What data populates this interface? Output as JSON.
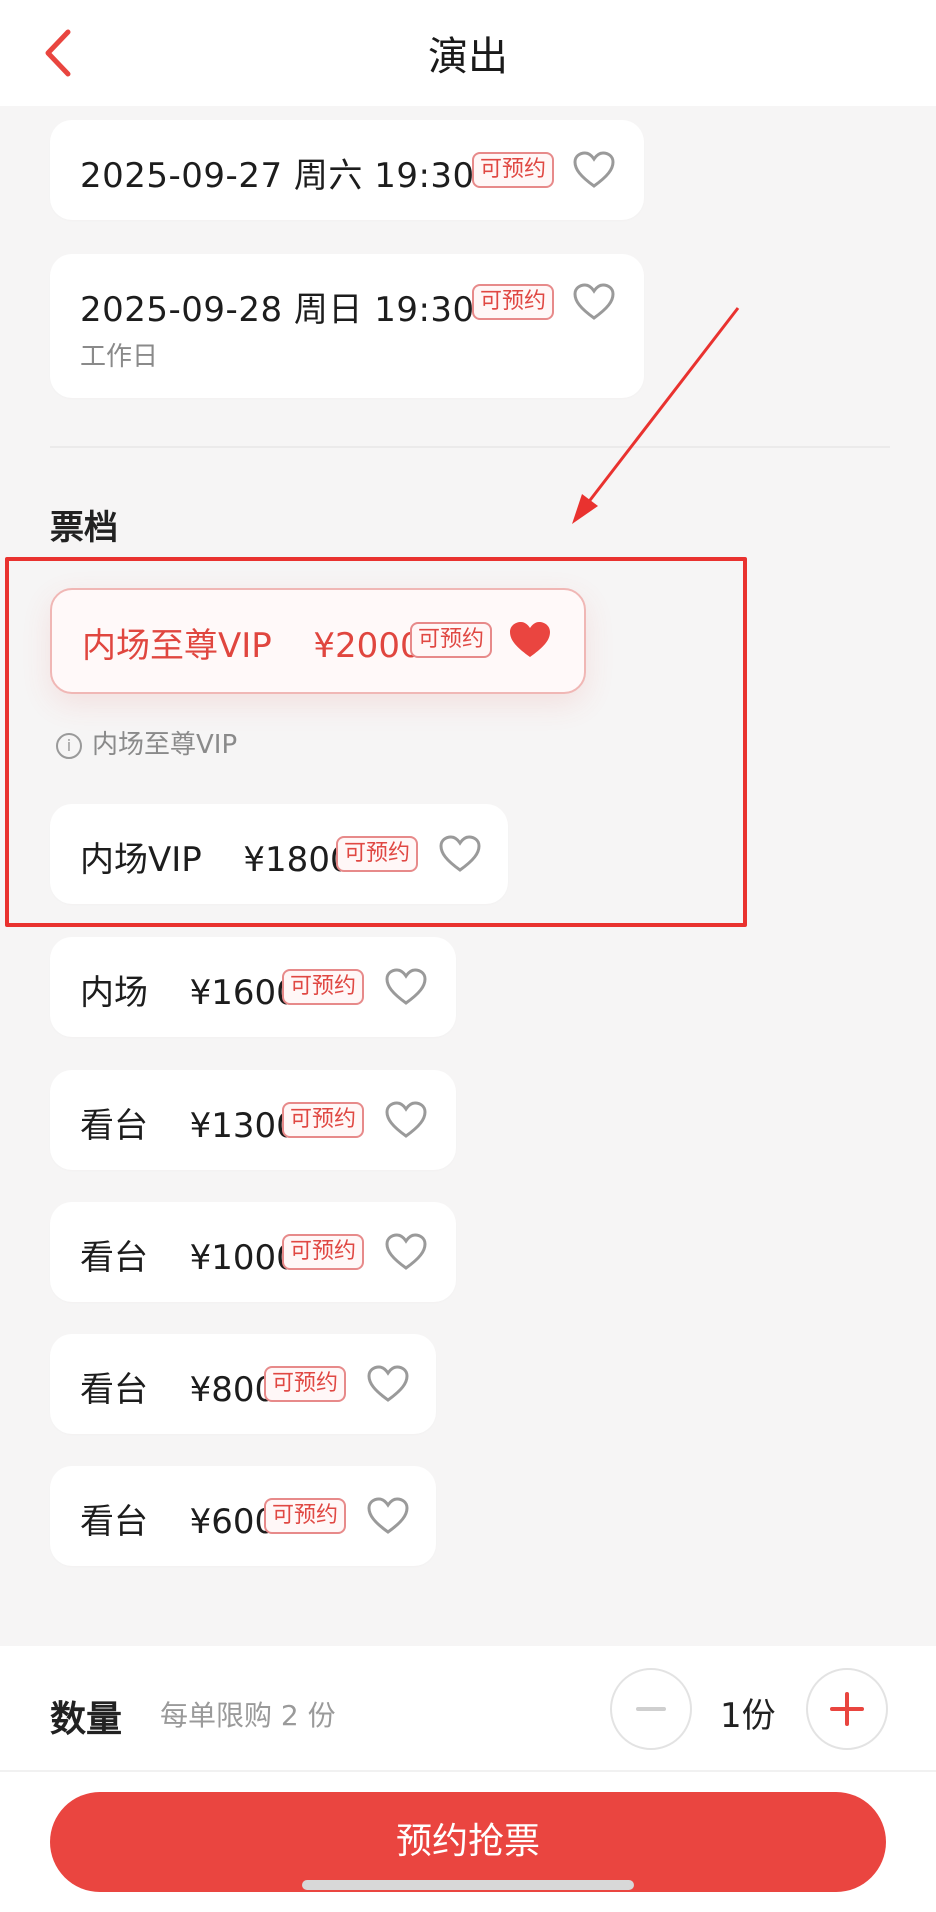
{
  "header": {
    "title": "演出",
    "back_icon": "chevron-left-icon"
  },
  "dates": [
    {
      "date": "2025-09-27 周六 19:30",
      "badge": "可预约",
      "sub": ""
    },
    {
      "date": "2025-09-28 周日 19:30",
      "badge": "可预约",
      "sub": "工作日"
    }
  ],
  "tiers_section": {
    "title": "票档"
  },
  "selected_tier": {
    "name": "内场至尊VIP",
    "price": "¥2000",
    "badge": "可预约",
    "info": "内场至尊VIP",
    "favorited": true
  },
  "tiers": [
    {
      "name": "内场VIP",
      "price": "¥1800",
      "badge": "可预约"
    },
    {
      "name": "内场",
      "price": "¥1600",
      "badge": "可预约"
    },
    {
      "name": "看台",
      "price": "¥1300",
      "badge": "可预约"
    },
    {
      "name": "看台",
      "price": "¥1000",
      "badge": "可预约"
    },
    {
      "name": "看台",
      "price": "¥800",
      "badge": "可预约"
    },
    {
      "name": "看台",
      "price": "¥600",
      "badge": "可预约"
    }
  ],
  "quantity": {
    "label": "数量",
    "limit": "每单限购 2 份",
    "value": "1份",
    "minus_icon": "minus-icon",
    "plus_icon": "plus-icon"
  },
  "action": {
    "label": "预约抢票"
  },
  "colors": {
    "accent": "#ea4540",
    "badge_border": "#e78a8a",
    "annotation": "#e9322f"
  }
}
